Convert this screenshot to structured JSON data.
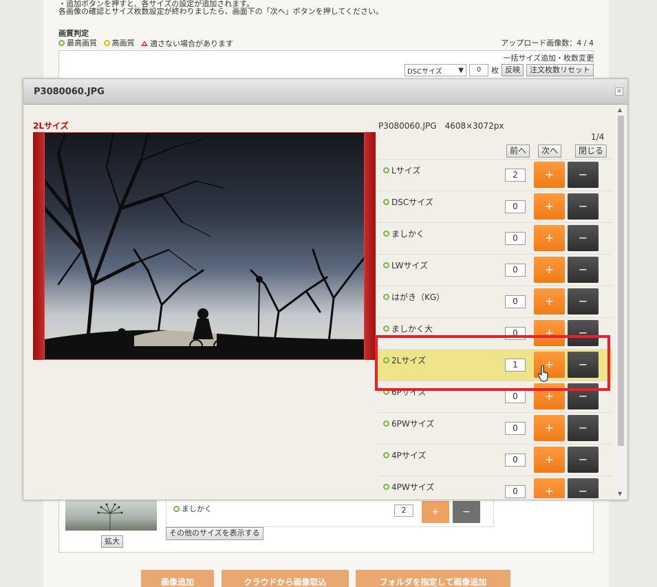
{
  "background": {
    "header_line": "・追加ボタンを押すと、各サイズの設定が追加されます。",
    "notice": "各画像の確認とサイズ枚数設定が終わりましたら、画面下の「次へ」ボタンを押してください。",
    "quality": {
      "title": "画質判定",
      "best": "最高画質",
      "high": "高画質",
      "warning": "適さない場合があります"
    },
    "upload_count": "アップロード画像数：4 / 4",
    "bulk": {
      "link": "一括サイズ追加・枚数変更",
      "select_value": "DSCサイズ",
      "count": "0",
      "unit": "枚",
      "apply": "反映",
      "reset": "注文枚数リセット"
    },
    "card": {
      "zoom": "拡大",
      "item_label": "ましかく",
      "item_qty": "2",
      "plus": "+",
      "minus": "−",
      "show_more": "その他のサイズを表示する"
    },
    "bottom_buttons": [
      "画像追加",
      "クラウドから画像取込",
      "フォルダを指定して画像追加"
    ]
  },
  "modal": {
    "title": "P3080060.JPG",
    "close": "×",
    "size_label": "2Lサイズ",
    "file_info": "P3080060.JPG　4608×3072px",
    "page": "1/4",
    "prev": "前へ",
    "next": "次へ",
    "close_btn": "閉じる",
    "plus": "+",
    "minus": "−",
    "sizes": [
      {
        "label": "Lサイズ",
        "qty": "2"
      },
      {
        "label": "DSCサイズ",
        "qty": "0"
      },
      {
        "label": "ましかく",
        "qty": "0"
      },
      {
        "label": "LWサイズ",
        "qty": "0"
      },
      {
        "label": "はがき（KG）",
        "qty": "0"
      },
      {
        "label": "ましかく大",
        "qty": "0"
      },
      {
        "label": "2Lサイズ",
        "qty": "1"
      },
      {
        "label": "6Pサイズ",
        "qty": "0"
      },
      {
        "label": "6PWサイズ",
        "qty": "0"
      },
      {
        "label": "4Pサイズ",
        "qty": "0"
      },
      {
        "label": "4PWサイズ",
        "qty": "0"
      }
    ]
  },
  "colors": {
    "accent_orange": "#f07a18",
    "dark_button": "#2e2e2e",
    "selected_row": "#eee48a",
    "highlight": "#e8202a",
    "size_label": "#cc0000"
  }
}
